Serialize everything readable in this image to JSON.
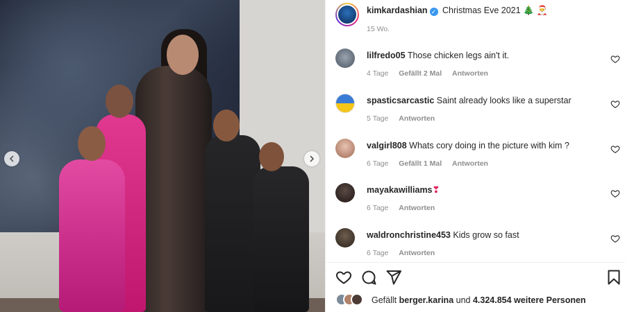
{
  "post": {
    "author": "kimkardashian",
    "caption": "Christmas Eve 2021",
    "caption_emojis": [
      "🎄",
      "🎅"
    ],
    "time_ago": "15 Wo."
  },
  "comments": [
    {
      "username": "lilfredo05",
      "text": "Those chicken legs ain't it.",
      "time": "4 Tage",
      "likes": "Gefällt 2 Mal",
      "reply": "Antworten"
    },
    {
      "username": "spasticsarcastic",
      "text": "Saint already looks like a superstar",
      "time": "5 Tage",
      "likes": "",
      "reply": "Antworten"
    },
    {
      "username": "valgirl808",
      "text": "Whats cory doing in the picture with kim ?",
      "time": "6 Tage",
      "likes": "Gefällt 1 Mal",
      "reply": "Antworten"
    },
    {
      "username": "mayakawilliams",
      "text": "❣",
      "time": "6 Tage",
      "likes": "",
      "reply": "Antworten"
    },
    {
      "username": "waldronchristine453",
      "text": "Kids grow so fast",
      "time": "6 Tage",
      "likes": "",
      "reply": "Antworten"
    }
  ],
  "likes_line": {
    "prefix": "Gefällt",
    "user": "berger.karina",
    "middle": "und",
    "count": "4.324.854 weitere Personen"
  },
  "icons": {
    "like": "heart-icon",
    "comment": "comment-icon",
    "share": "share-icon",
    "save": "bookmark-icon",
    "carousel_prev": "chevron-left-icon",
    "carousel_next": "chevron-right-icon",
    "verified": "verified-badge-icon"
  },
  "colors": {
    "text": "#262626",
    "muted": "#8e8e8e",
    "verified": "#3897f0",
    "divider": "#efefef"
  }
}
